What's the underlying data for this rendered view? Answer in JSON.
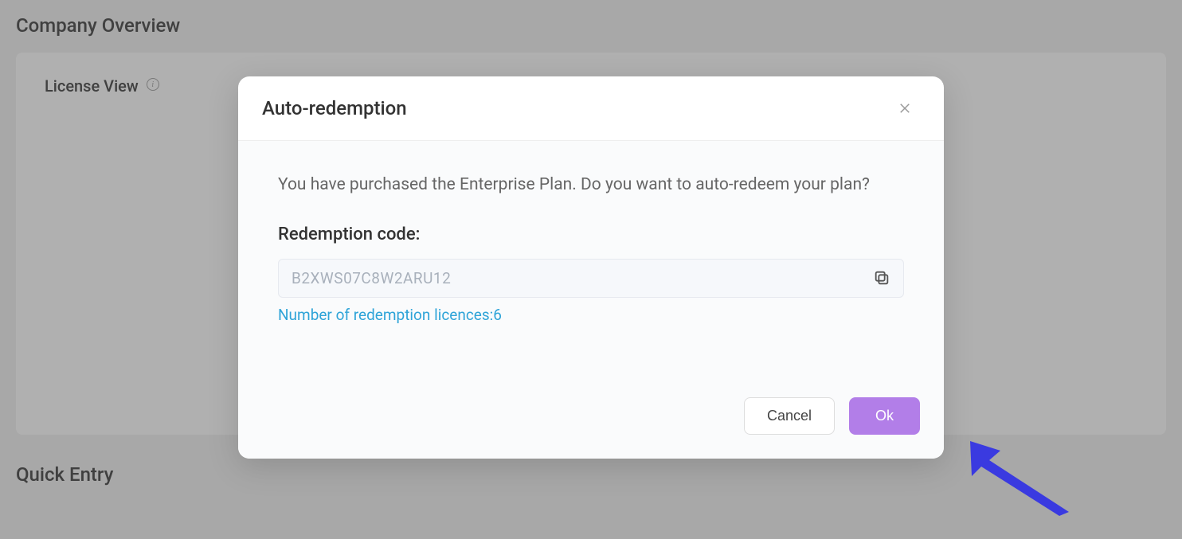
{
  "page": {
    "company_overview": "Company Overview",
    "license_view": "License View",
    "quick_entry": "Quick Entry"
  },
  "modal": {
    "title": "Auto-redemption",
    "prompt": "You have purchased the Enterprise Plan. Do you want to auto-redeem your plan?",
    "redemption_label": "Redemption code:",
    "code": "B2XWS07C8W2ARU12",
    "licences_text": "Number of redemption licences:6",
    "cancel": "Cancel",
    "ok": "Ok"
  }
}
